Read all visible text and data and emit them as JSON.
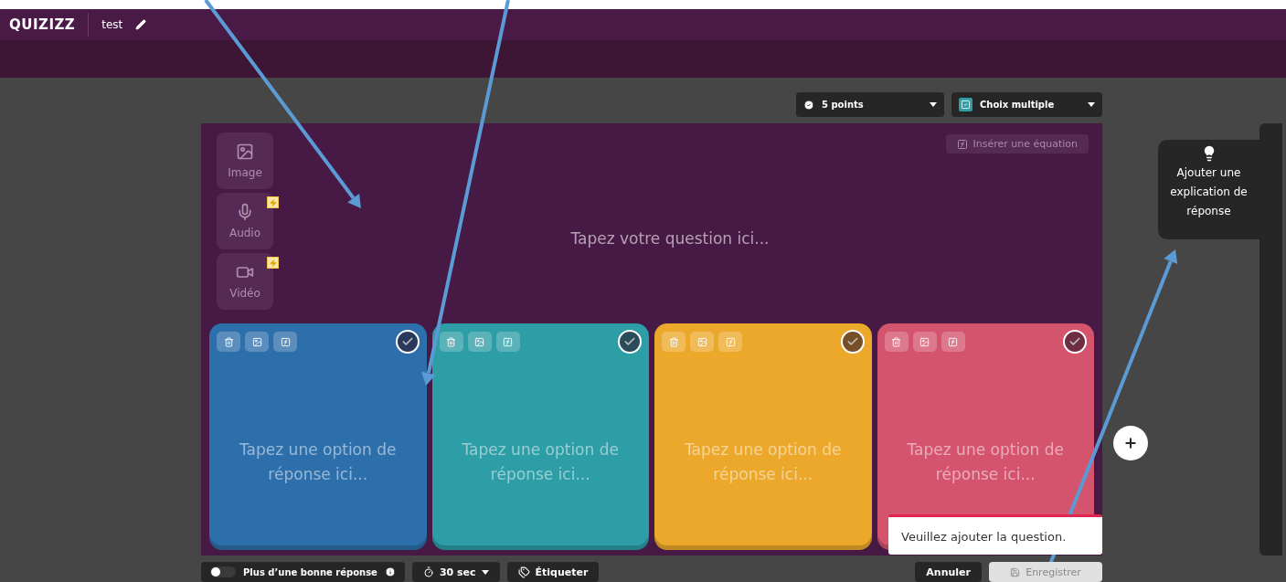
{
  "header": {
    "logo": "QUIZIZZ",
    "quiz_title": "test"
  },
  "settings": {
    "points": "5 points",
    "question_type": "Choix multiple"
  },
  "media_buttons": [
    {
      "label": "Image",
      "kind": "image",
      "premium": false
    },
    {
      "label": "Audio",
      "kind": "audio",
      "premium": true
    },
    {
      "label": "Vidéo",
      "kind": "video",
      "premium": true
    }
  ],
  "equation_button": "Insérer une équation",
  "question": {
    "placeholder": "Tapez votre question ici..."
  },
  "options": [
    {
      "placeholder": "Tapez une option de réponse ici...",
      "color": "#2d6fab",
      "correct": false
    },
    {
      "placeholder": "Tapez une option de réponse ici...",
      "color": "#2d9da6",
      "correct": false
    },
    {
      "placeholder": "Tapez une option de réponse ici...",
      "color": "#eca82b",
      "correct": false
    },
    {
      "placeholder": "Tapez une option de réponse ici...",
      "color": "#d4546d",
      "correct": false
    }
  ],
  "explanation_button": "Ajouter une explication de réponse",
  "toast": "Veuillez ajouter la question.",
  "footer": {
    "multiple_answers": {
      "label": "Plus d’une bonne réponse",
      "on": false
    },
    "timer": "30 sec",
    "tag_button": "Étiqueter",
    "cancel_button": "Annuler",
    "save_button": {
      "label": "Enregistrer",
      "disabled": true
    }
  }
}
